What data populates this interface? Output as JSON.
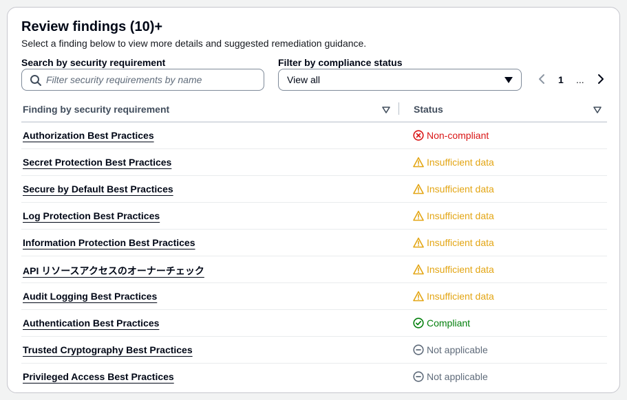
{
  "header": {
    "title": "Review findings (10)+",
    "description": "Select a finding below to view more details and suggested remediation guidance."
  },
  "search": {
    "label": "Search by security requirement",
    "placeholder": "Filter security requirements by name"
  },
  "filter": {
    "label": "Filter by compliance status",
    "selected": "View all"
  },
  "pagination": {
    "current_page": "1",
    "ellipsis": "..."
  },
  "table": {
    "columns": [
      "Finding by security requirement",
      "Status"
    ],
    "rows": [
      {
        "name": "Authorization Best Practices",
        "status": "Non-compliant",
        "kind": "noncompliant"
      },
      {
        "name": "Secret Protection Best Practices",
        "status": "Insufficient data",
        "kind": "warning"
      },
      {
        "name": "Secure by Default Best Practices",
        "status": "Insufficient data",
        "kind": "warning"
      },
      {
        "name": "Log Protection Best Practices",
        "status": "Insufficient data",
        "kind": "warning"
      },
      {
        "name": "Information Protection Best Practices",
        "status": "Insufficient data",
        "kind": "warning"
      },
      {
        "name": "API リソースアクセスのオーナーチェック",
        "status": "Insufficient data",
        "kind": "warning"
      },
      {
        "name": "Audit Logging Best Practices",
        "status": "Insufficient data",
        "kind": "warning"
      },
      {
        "name": "Authentication Best Practices",
        "status": "Compliant",
        "kind": "compliant"
      },
      {
        "name": "Trusted Cryptography Best Practices",
        "status": "Not applicable",
        "kind": "na"
      },
      {
        "name": "Privileged Access Best Practices",
        "status": "Not applicable",
        "kind": "na"
      }
    ]
  },
  "colors": {
    "noncompliant": "#d91515",
    "warning": "#e3a513",
    "compliant": "#037f0c",
    "na": "#5f6b7a"
  },
  "icons": {
    "noncompliant": "error-circle-icon",
    "warning": "warning-triangle-icon",
    "compliant": "check-circle-icon",
    "na": "minus-circle-icon"
  }
}
